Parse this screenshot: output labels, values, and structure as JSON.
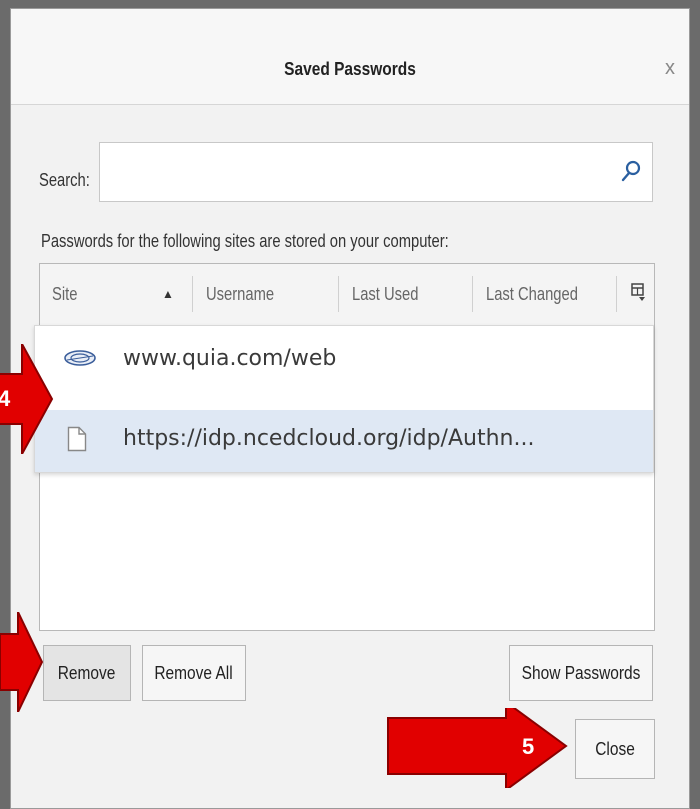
{
  "window": {
    "title": "Saved Passwords",
    "close_glyph": "x"
  },
  "search": {
    "label": "Search:",
    "value": "",
    "placeholder": ""
  },
  "info_text": "Passwords for the following sites are stored on your computer:",
  "columns": [
    {
      "label": "Site",
      "sorted": "ascending"
    },
    {
      "label": "Username"
    },
    {
      "label": "Last Used"
    },
    {
      "label": "Last Changed"
    }
  ],
  "sort_indicator": "▲",
  "dropdown_rows": [
    {
      "icon": "quia-site-icon",
      "text": "www.quia.com/web",
      "selected": false
    },
    {
      "icon": "blank-page-icon",
      "text": "https://idp.ncedcloud.org/idp/Authn...",
      "selected": true
    }
  ],
  "buttons": {
    "remove": "Remove",
    "remove_all": "Remove All",
    "show_passwords": "Show Passwords",
    "close": "Close"
  },
  "callouts": [
    {
      "label": "4",
      "color": "#e10000"
    },
    {
      "label": "5",
      "color": "#e10000"
    }
  ],
  "colors": {
    "accent": "#3a8ad6",
    "selection": "#dfe8f4",
    "callout": "#e10000"
  }
}
